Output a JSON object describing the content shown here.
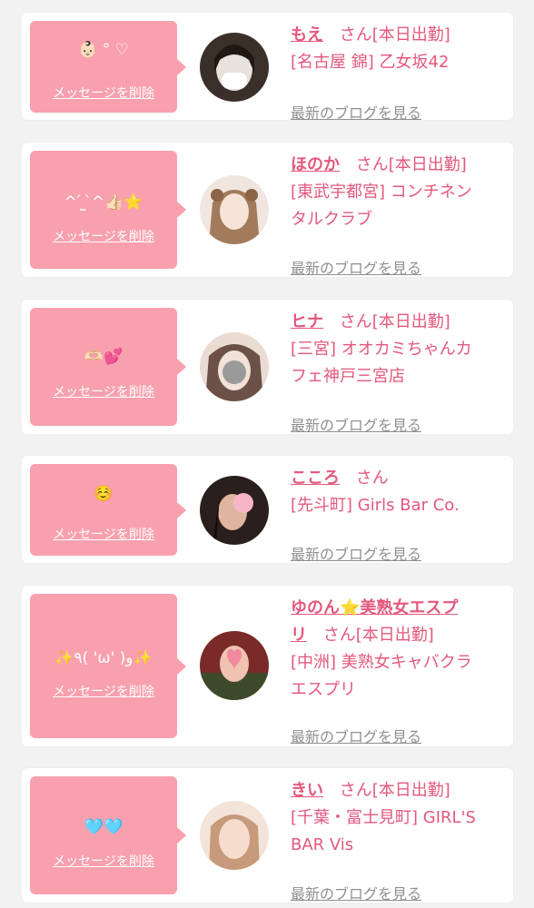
{
  "cards": [
    {
      "message": "👶🏻 ° ♡",
      "delete_label": "メッセージを削除",
      "name": "もえ",
      "san": "さん",
      "status": "[本日出勤]",
      "shop_lines": [
        "[名古屋 錦] 乙女坂42"
      ],
      "blog_label": "最新のブログを見る",
      "avatar_colors": [
        "#3b2f2a",
        "#e8e2dc"
      ]
    },
    {
      "message": "^ ́ ̫ ̀^👍🏻⭐️",
      "delete_label": "メッセージを削除",
      "name": "ほのか",
      "san": "さん",
      "status": "[本日出勤]",
      "shop_lines": [
        "[東武宇都宮] コンチネン",
        "タルクラブ"
      ],
      "blog_label": "最新のブログを見る",
      "avatar_colors": [
        "#c7a88c",
        "#f1e6df"
      ]
    },
    {
      "message": "🫶🏻💕",
      "delete_label": "メッセージを削除",
      "name": "ヒナ",
      "san": "さん",
      "status": "[本日出勤]",
      "shop_lines": [
        "[三宮] オオカミちゃんカ",
        "フェ神戸三宮店"
      ],
      "blog_label": "最新のブログを見る",
      "avatar_colors": [
        "#8a6f63",
        "#eadbd3"
      ]
    },
    {
      "message": "☺️",
      "delete_label": "メッセージを削除",
      "name": "こころ",
      "san": "さん",
      "status": "",
      "shop_lines": [
        "[先斗町] Girls Bar Co."
      ],
      "blog_label": "最新のブログを見る",
      "avatar_colors": [
        "#2a1f1c",
        "#d9a58f"
      ]
    },
    {
      "message": "✨٩( 'ω' )و✨",
      "delete_label": "メッセージを削除",
      "name": "ゆのん",
      "name_extra": "⭐美熟女エスプ",
      "name_cont": "リ",
      "san": "さん",
      "status": "[本日出勤]",
      "shop_lines": [
        "[中洲] 美熟女キャバクラ",
        "エスプリ"
      ],
      "blog_label": "最新のブログを見る",
      "avatar_colors": [
        "#7a2a28",
        "#f08a9e"
      ]
    },
    {
      "message": "🩵🩵",
      "delete_label": "メッセージを削除",
      "name": "きい",
      "san": "さん",
      "status": "[本日出勤]",
      "shop_lines": [
        "[千葉・富士見町] GIRL'S",
        "BAR Vis"
      ],
      "blog_label": "最新のブログを見る",
      "avatar_colors": [
        "#c79a7c",
        "#f3e3d8"
      ]
    }
  ]
}
